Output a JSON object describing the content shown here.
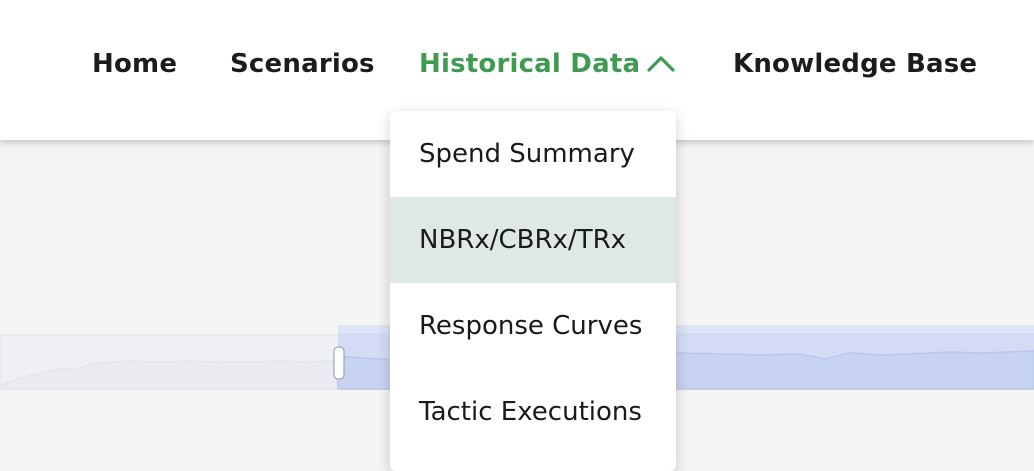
{
  "nav": {
    "items": [
      {
        "label": "Home"
      },
      {
        "label": "Scenarios"
      },
      {
        "label": "Historical Data",
        "active": true,
        "expanded": true
      },
      {
        "label": "Knowledge Base"
      }
    ],
    "active_color": "#3f9a52",
    "chevron_icon": "chevron-up-icon"
  },
  "dropdown": {
    "items": [
      {
        "label": "Spend Summary"
      },
      {
        "label": "NBRx/CBRx/TRx",
        "highlighted": true
      },
      {
        "label": "Response Curves"
      },
      {
        "label": "Tactic Executions"
      }
    ],
    "highlight_color": "#dde9e2"
  },
  "background_chart": {
    "selection_fill": "#d3dcf4",
    "line_color": "#b9c6ea"
  }
}
